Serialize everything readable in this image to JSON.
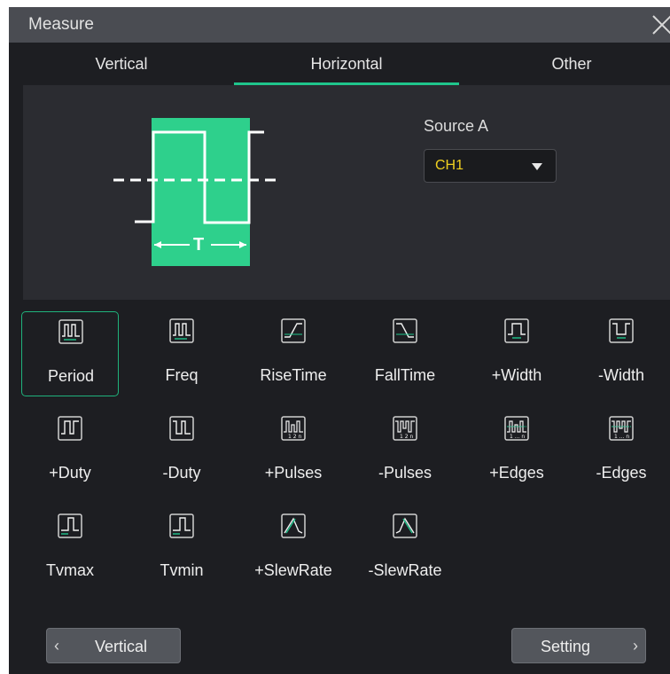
{
  "title": "Measure",
  "tabs": [
    {
      "label": "Vertical",
      "active": false
    },
    {
      "label": "Horizontal",
      "active": true
    },
    {
      "label": "Other",
      "active": false
    }
  ],
  "preview": {
    "diagram_label": "T",
    "source_label": "Source A",
    "source_value": "CH1",
    "source_value_color": "#f0d020"
  },
  "items": [
    {
      "label": "Period",
      "icon": "period-icon",
      "selected": true
    },
    {
      "label": "Freq",
      "icon": "freq-icon"
    },
    {
      "label": "RiseTime",
      "icon": "rise-time-icon"
    },
    {
      "label": "FallTime",
      "icon": "fall-time-icon"
    },
    {
      "label": "+Width",
      "icon": "positive-width-icon"
    },
    {
      "label": "-Width",
      "icon": "negative-width-icon"
    },
    {
      "label": "+Duty",
      "icon": "positive-duty-icon"
    },
    {
      "label": "-Duty",
      "icon": "negative-duty-icon"
    },
    {
      "label": "+Pulses",
      "icon": "positive-pulses-icon"
    },
    {
      "label": "-Pulses",
      "icon": "negative-pulses-icon"
    },
    {
      "label": "+Edges",
      "icon": "positive-edges-icon"
    },
    {
      "label": "-Edges",
      "icon": "negative-edges-icon"
    },
    {
      "label": "Tvmax",
      "icon": "tvmax-icon"
    },
    {
      "label": "Tvmin",
      "icon": "tvmin-icon"
    },
    {
      "label": "+SlewRate",
      "icon": "positive-slew-rate-icon"
    },
    {
      "label": "-SlewRate",
      "icon": "negative-slew-rate-icon"
    }
  ],
  "nav": {
    "prev_label": "Vertical",
    "next_label": "Setting"
  },
  "colors": {
    "accent": "#1fc58c",
    "wave_fill": "#2ed08c",
    "background": "#1d1e22",
    "title_bar": "#4a4c52",
    "preview_panel": "#2b2c31"
  }
}
